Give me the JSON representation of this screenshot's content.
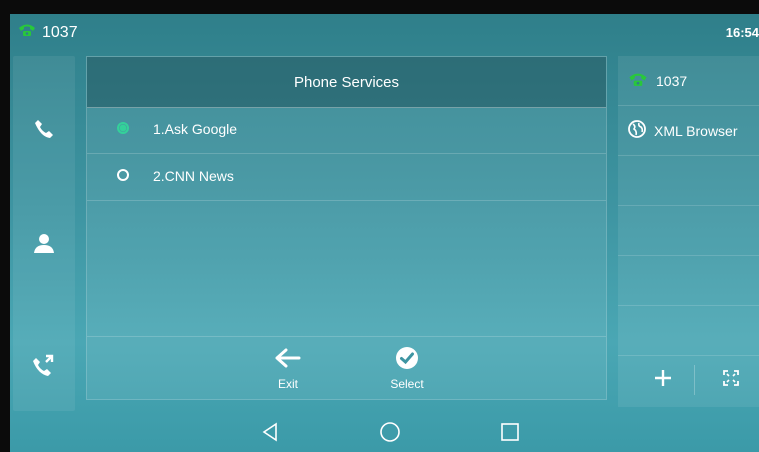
{
  "status": {
    "account": "1037",
    "time": "16:54"
  },
  "rail": {
    "items": [
      "phone-icon",
      "contacts-icon",
      "call-history-icon"
    ]
  },
  "panel": {
    "title": "Phone Services",
    "items": [
      {
        "label": "1.Ask Google",
        "selected": true
      },
      {
        "label": "2.CNN News",
        "selected": false
      }
    ],
    "softkeys": {
      "exit": "Exit",
      "select": "Select"
    }
  },
  "right_panel": {
    "account": "1037",
    "xml_browser": "XML Browser"
  },
  "colors": {
    "accent_green": "#34d19a",
    "phone_green": "#28c83a"
  }
}
